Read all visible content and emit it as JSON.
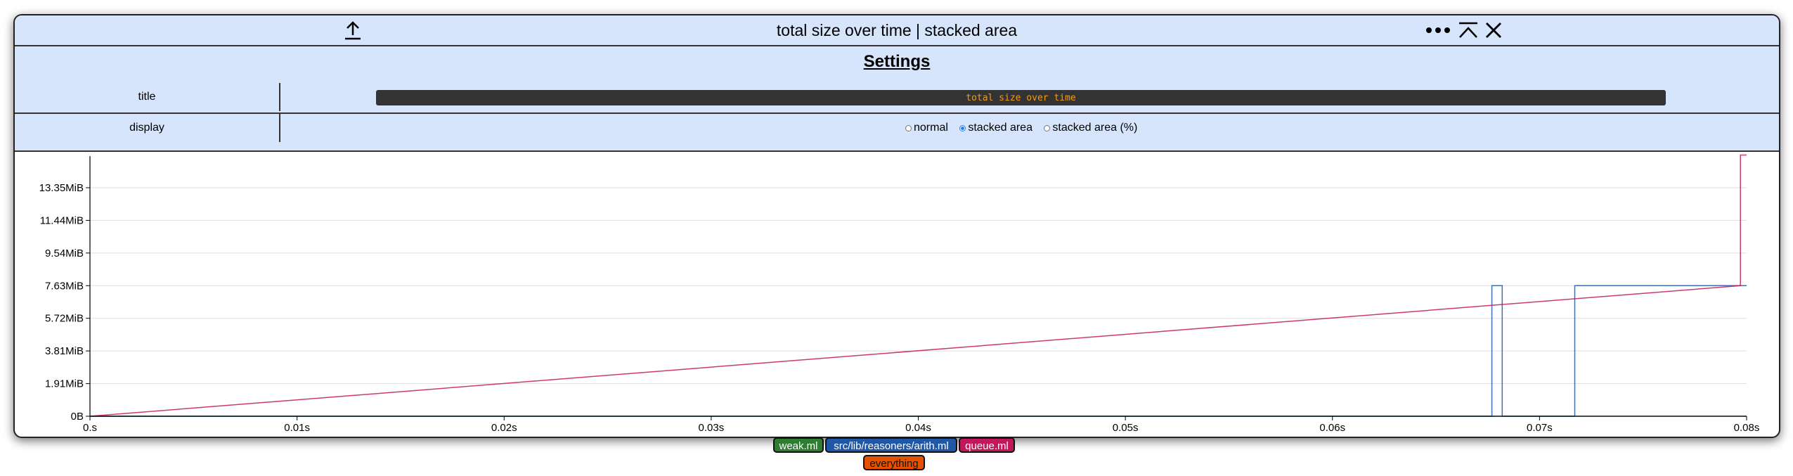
{
  "window": {
    "title": "total size over time | stacked area",
    "icons": [
      "upload-icon",
      "more-icon",
      "collapse-icon",
      "close-icon"
    ]
  },
  "settings": {
    "heading": "Settings",
    "title_label": "title",
    "title_value": "total size over time",
    "display_label": "display",
    "display_options": [
      "normal",
      "stacked area",
      "stacked area (%)"
    ],
    "display_selected": "stacked area"
  },
  "chart_data": {
    "type": "area",
    "stacked": true,
    "title": "total size over time",
    "xlabel": "",
    "ylabel": "",
    "x_ticks": [
      "0.s",
      "0.01s",
      "0.02s",
      "0.03s",
      "0.04s",
      "0.05s",
      "0.06s",
      "0.07s",
      "0.08s"
    ],
    "y_ticks": [
      "0B",
      "1.91MiB",
      "3.81MiB",
      "5.72MiB",
      "7.63MiB",
      "9.54MiB",
      "11.44MiB",
      "13.35MiB"
    ],
    "xlim": [
      0,
      0.08
    ],
    "ylim_mib": [
      0,
      15.2
    ],
    "grid": true,
    "series": [
      {
        "name": "weak.ml",
        "color": "#2e7d32",
        "x": [
          0,
          0.08
        ],
        "y": [
          0,
          0
        ]
      },
      {
        "name": "src/lib/reasoners/arith.ml",
        "color": "#2057a6",
        "x": [
          0,
          0.0677,
          0.0677,
          0.0682,
          0.0682,
          0.0717,
          0.0717,
          0.08
        ],
        "y": [
          0,
          0,
          7.63,
          7.63,
          0,
          0,
          7.63,
          7.63
        ]
      },
      {
        "name": "queue.ml",
        "color": "#c2185b",
        "x": [
          0,
          0.0797,
          0.0797,
          0.08
        ],
        "y": [
          0,
          0,
          7.63,
          7.63
        ]
      }
    ]
  },
  "legend": {
    "items": [
      {
        "label": "weak.ml",
        "color": "#2e7d32"
      },
      {
        "label": "src/lib/reasoners/arith.ml",
        "color": "#2057a6"
      },
      {
        "label": "queue.ml",
        "color": "#c2185b"
      }
    ],
    "everything_label": "everything",
    "everything_color": "#e65100"
  }
}
